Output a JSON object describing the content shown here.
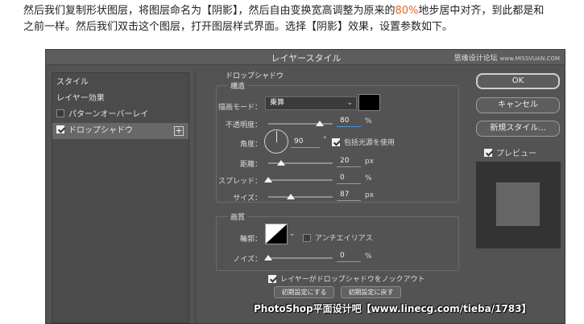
{
  "intro": {
    "line1_a": "然后我们复制形状图层，将图层命名为【阴影】，然后自由变换宽高调整为原来的",
    "line1_hl": "80%",
    "line1_b": "地步居中对齐，到此都是和",
    "line2": "之前一样。然后我们双击这个图层，打开图层样式界面。选择【阴影】效果，设置参数如下。"
  },
  "dialog": {
    "title": "レイヤースタイル",
    "watermark": "思缘设计论坛",
    "watermark_url": "www.MISSVUAN.COM"
  },
  "left_panel": {
    "items": [
      {
        "label": "スタイル",
        "checkbox": false,
        "checked": false,
        "selected": false
      },
      {
        "label": "レイヤー効果",
        "checkbox": false,
        "checked": false,
        "selected": false
      },
      {
        "label": "パターンオーバーレイ",
        "checkbox": true,
        "checked": false,
        "selected": false
      },
      {
        "label": "ドロップシャドウ",
        "checkbox": true,
        "checked": true,
        "selected": true
      }
    ],
    "add_symbol": "+"
  },
  "structure": {
    "section": "ドロップシャドウ",
    "group": "構造",
    "blend_label": "描画モード：",
    "blend_value": "乗算",
    "opacity_label": "不透明度：",
    "opacity_value": "80",
    "angle_label": "角度：",
    "angle_value": "90",
    "degree_symbol": "°",
    "global_light_label": "包括光源を使用",
    "distance_label": "距離：",
    "distance_value": "20",
    "spread_label": "スプレッド：",
    "spread_value": "0",
    "size_label": "サイズ：",
    "size_value": "87",
    "unit_px": "px",
    "unit_pct": "%"
  },
  "sliders": {
    "opacity": 0.8,
    "distance": 0.2,
    "spread": 0.0,
    "size": 0.35
  },
  "quality": {
    "group": "画質",
    "contour_label": "輪郭：",
    "antialias_label": "アンチエイリアス",
    "noise_label": "ノイズ：",
    "noise_value": "0",
    "unit_pct": "%"
  },
  "knockout_label": "レイヤーがドロップシャドウをノックアウト",
  "buttons": {
    "make_default": "初期設定にする",
    "reset_default": "初期設定に戻す",
    "ok": "OK",
    "cancel": "キャンセル",
    "new_style": "新規スタイル...",
    "preview": "プレビュー"
  },
  "footer": "PhotoShop平面设计吧【www.linecg.com/tieba/1783】",
  "colors": {
    "dialog_bg": "#535353",
    "highlight": "#e8632c",
    "shadow_color": "#000000"
  }
}
